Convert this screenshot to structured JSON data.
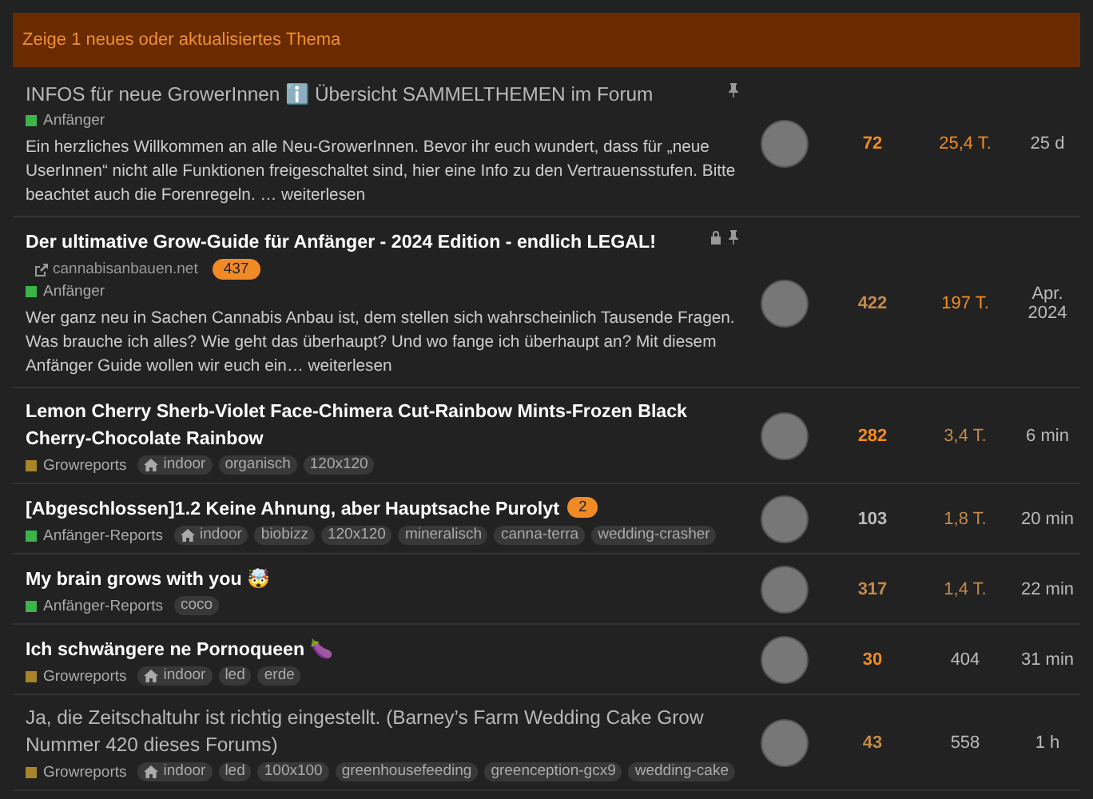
{
  "banner": {
    "text": "Zeige 1 neues oder aktualisiertes Thema"
  },
  "topics": [
    {
      "title": "INFOS für neue GrowerInnen ℹ️ Übersicht SAMMELTHEMEN im Forum",
      "unread": false,
      "pinned": true,
      "closed": false,
      "category": {
        "name": "Anfänger",
        "color": "#3ab54a"
      },
      "excerpt": "Ein herzliches Willkommen an alle Neu-GrowerInnen. Bevor ihr euch wundert, dass für „neue UserInnen“ nicht alle Funktionen freigeschaltet sind, hier eine Info zu den Vertrauensstufen. Bitte beachtet auch die Forenregeln. …",
      "more": "weiterlesen",
      "replies": {
        "label": "72",
        "color": "#f58b1f"
      },
      "views": {
        "label": "25,4 T.",
        "color": "#f58b1f"
      },
      "activity": "25 d"
    },
    {
      "title": "Der ultimative Grow-Guide für Anfänger - 2024 Edition - endlich LEGAL!",
      "unread": true,
      "pinned": true,
      "closed": true,
      "link": "cannabisanbauen.net",
      "new_posts": "437",
      "category": {
        "name": "Anfänger",
        "color": "#3ab54a"
      },
      "excerpt": "Wer ganz neu in Sachen Cannabis Anbau ist, dem stellen sich wahrscheinlich Tausende Fragen. Was brauche ich alles? Wie geht das überhaupt? Und wo fange ich überhaupt an? Mit diesem Anfänger Guide wollen wir euch ein…",
      "more": "weiterlesen",
      "replies": {
        "label": "422",
        "color": "#c48a4a"
      },
      "views": {
        "label": "197 T.",
        "color": "#f58b1f"
      },
      "activity": "Apr. 2024"
    },
    {
      "title": "Lemon Cherry Sherb-Violet Face-Chimera Cut-Rainbow Mints-Frozen Black Cherry-Chocolate Rainbow",
      "unread": true,
      "pinned": false,
      "closed": false,
      "category": {
        "name": "Growreports",
        "color": "#a8852a"
      },
      "tags": [
        {
          "label": "indoor",
          "kind": "home"
        },
        {
          "label": "organisch",
          "kind": "plain"
        },
        {
          "label": "120x120",
          "kind": "plain"
        }
      ],
      "replies": {
        "label": "282",
        "color": "#f58b1f"
      },
      "views": {
        "label": "3,4 T.",
        "color": "#c48a4a"
      },
      "activity": "6 min"
    },
    {
      "title": "[Abgeschlossen]1.2 Keine Ahnung, aber Hauptsache Purolyt",
      "unread": true,
      "pinned": false,
      "closed": false,
      "new_posts": "2",
      "category": {
        "name": "Anfänger-Reports",
        "color": "#3ab54a"
      },
      "tags": [
        {
          "label": "indoor",
          "kind": "home"
        },
        {
          "label": "biobizz",
          "kind": "plain"
        },
        {
          "label": "120x120",
          "kind": "plain"
        },
        {
          "label": "mineralisch",
          "kind": "plain"
        },
        {
          "label": "canna-terra",
          "kind": "plain"
        },
        {
          "label": "wedding-crasher",
          "kind": "plain"
        }
      ],
      "replies": {
        "label": "103",
        "color": "#bbbbbb"
      },
      "views": {
        "label": "1,8 T.",
        "color": "#c48a4a"
      },
      "activity": "20 min"
    },
    {
      "title": "My brain grows with you 🤯",
      "unread": true,
      "pinned": false,
      "closed": false,
      "category": {
        "name": "Anfänger-Reports",
        "color": "#3ab54a"
      },
      "tags": [
        {
          "label": "coco",
          "kind": "plain"
        }
      ],
      "replies": {
        "label": "317",
        "color": "#c48a4a"
      },
      "views": {
        "label": "1,4 T.",
        "color": "#c48a4a"
      },
      "activity": "22 min"
    },
    {
      "title": "Ich schwängere ne Pornoqueen 🍆",
      "unread": true,
      "pinned": false,
      "closed": false,
      "category": {
        "name": "Growreports",
        "color": "#a8852a"
      },
      "tags": [
        {
          "label": "indoor",
          "kind": "home"
        },
        {
          "label": "led",
          "kind": "plain"
        },
        {
          "label": "erde",
          "kind": "plain"
        }
      ],
      "replies": {
        "label": "30",
        "color": "#f58b1f"
      },
      "views": {
        "label": "404",
        "color": "#bbbbbb"
      },
      "activity": "31 min"
    },
    {
      "title": "Ja, die Zeitschaltuhr ist richtig eingestellt. (Barney’s Farm Wedding Cake Grow Nummer 420 dieses Forums)",
      "unread": false,
      "pinned": false,
      "closed": false,
      "category": {
        "name": "Growreports",
        "color": "#a8852a"
      },
      "tags": [
        {
          "label": "indoor",
          "kind": "home"
        },
        {
          "label": "led",
          "kind": "plain"
        },
        {
          "label": "100x100",
          "kind": "plain"
        },
        {
          "label": "greenhousefeeding",
          "kind": "plain"
        },
        {
          "label": "greenception-gcx9",
          "kind": "plain"
        },
        {
          "label": "wedding-cake",
          "kind": "plain"
        }
      ],
      "replies": {
        "label": "43",
        "color": "#c48a4a"
      },
      "views": {
        "label": "558",
        "color": "#bbbbbb"
      },
      "activity": "1 h"
    }
  ]
}
